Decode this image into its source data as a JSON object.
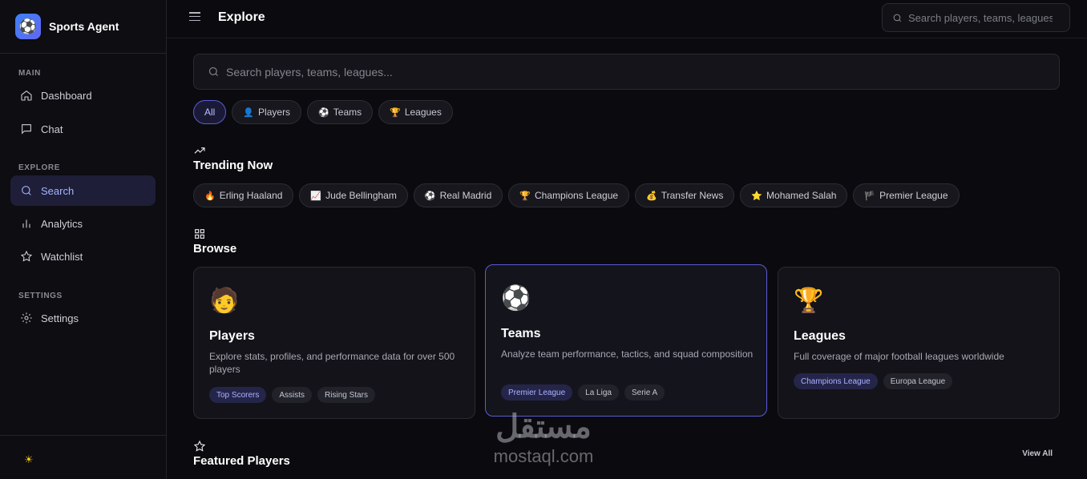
{
  "app": {
    "name": "Sports Agent",
    "logo_icon": "⚽"
  },
  "sidebar": {
    "sections": {
      "main": "MAIN",
      "explore": "EXPLORE",
      "settings": "SETTINGS"
    },
    "items": [
      {
        "label": "Dashboard",
        "icon": "home-icon",
        "active": false
      },
      {
        "label": "Chat",
        "icon": "chat-icon",
        "active": false
      },
      {
        "label": "Search",
        "icon": "search-icon",
        "active": true
      },
      {
        "label": "Analytics",
        "icon": "bar-chart-icon",
        "active": false
      },
      {
        "label": "Watchlist",
        "icon": "star-icon",
        "active": false
      },
      {
        "label": "Settings",
        "icon": "gear-icon",
        "active": false
      }
    ],
    "theme_toggle_icon": "☀"
  },
  "header": {
    "title": "Explore",
    "search_placeholder": "Search players, teams, leagues..."
  },
  "main": {
    "search_placeholder": "Search players, teams, leagues...",
    "filters": [
      {
        "label": "All",
        "emoji": "",
        "active": true
      },
      {
        "label": "Players",
        "emoji": "👤",
        "active": false
      },
      {
        "label": "Teams",
        "emoji": "⚽",
        "active": false
      },
      {
        "label": "Leagues",
        "emoji": "🏆",
        "active": false
      }
    ],
    "trending": {
      "title": "Trending Now",
      "items": [
        {
          "emoji": "🔥",
          "label": "Erling Haaland"
        },
        {
          "emoji": "📈",
          "label": "Jude Bellingham"
        },
        {
          "emoji": "⚽",
          "label": "Real Madrid"
        },
        {
          "emoji": "🏆",
          "label": "Champions League"
        },
        {
          "emoji": "💰",
          "label": "Transfer News"
        },
        {
          "emoji": "⭐",
          "label": "Mohamed Salah"
        },
        {
          "emoji": "🏴",
          "label": "Premier League"
        }
      ]
    },
    "browse": {
      "title": "Browse",
      "cards": [
        {
          "emoji": "🧑",
          "title": "Players",
          "description": "Explore stats, profiles, and performance data for over 500 players",
          "tags": [
            "Top Scorers",
            "Assists",
            "Rising Stars"
          ]
        },
        {
          "emoji": "⚽",
          "title": "Teams",
          "description": "Analyze team performance, tactics, and squad composition",
          "tags": [
            "Premier League",
            "La Liga",
            "Serie A"
          ]
        },
        {
          "emoji": "🏆",
          "title": "Leagues",
          "description": "Full coverage of major football leagues worldwide",
          "tags": [
            "Champions League",
            "Europa League"
          ]
        }
      ]
    },
    "featured": {
      "title": "Featured Players",
      "view_all": "View All"
    }
  },
  "watermark": {
    "arabic": "مستقل",
    "latin": "mostaql.com"
  }
}
